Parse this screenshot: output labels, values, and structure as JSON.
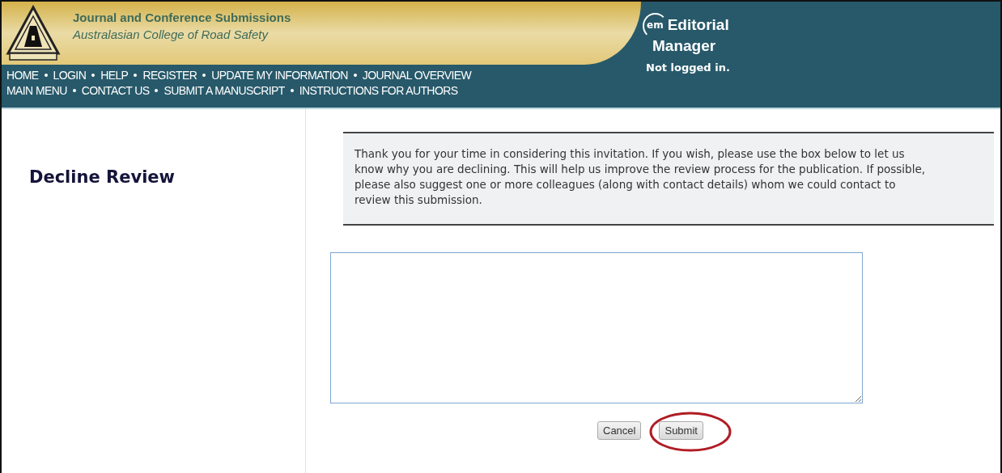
{
  "header": {
    "title": "Journal and Conference Submissions",
    "subtitle": "Australasian College of Road Safety",
    "nav_rows": [
      [
        "HOME",
        "LOGIN",
        "HELP",
        "REGISTER",
        "UPDATE MY INFORMATION",
        "JOURNAL OVERVIEW"
      ],
      [
        "MAIN MENU",
        "CONTACT US",
        "SUBMIT A MANUSCRIPT",
        "INSTRUCTIONS FOR AUTHORS"
      ]
    ],
    "brand": {
      "badge": "em",
      "line1": "Editorial",
      "line2": "Manager"
    },
    "login_status": "Not logged in."
  },
  "page_title": "Decline Review",
  "instructions": "Thank you for your time in considering this invitation. If you wish, please use the box below to let us know why you are declining. This will help us improve the review process for the publication. If possible, please also suggest one or more colleagues (along with contact details) whom we could contact to review this submission.",
  "buttons": [
    {
      "label": "Cancel",
      "highlighted": false
    },
    {
      "label": "Submit",
      "highlighted": true
    }
  ]
}
